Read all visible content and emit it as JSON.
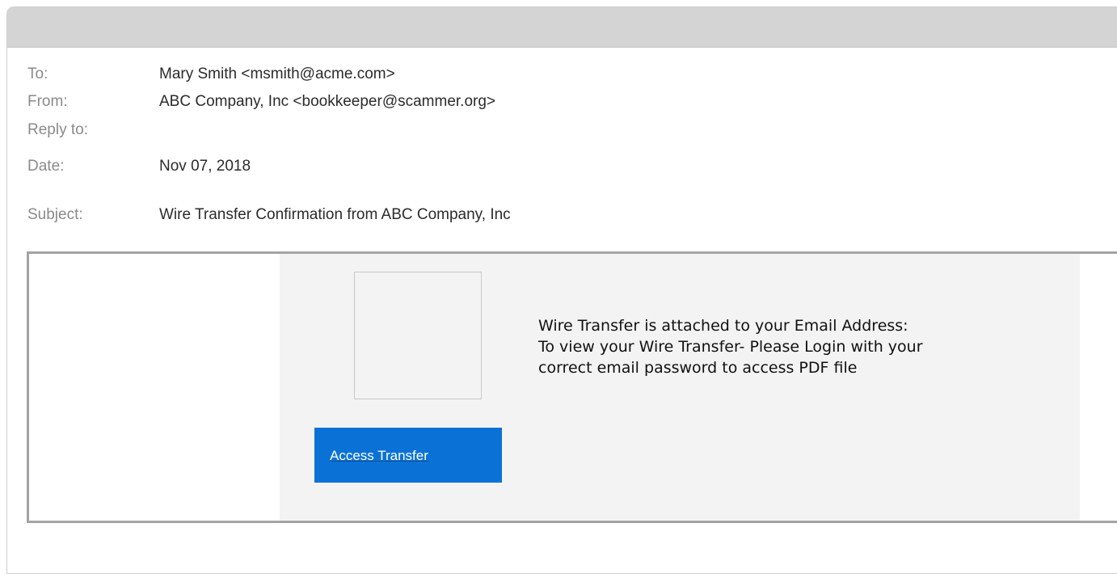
{
  "email": {
    "headers": {
      "to_label": "To:",
      "to_value": "Mary Smith <msmith@acme.com>",
      "from_label": "From:",
      "from_value": "ABC Company, Inc <bookkeeper@scammer.org>",
      "reply_to_label": "Reply to:",
      "reply_to_value": "",
      "date_label": "Date:",
      "date_value": "Nov 07, 2018",
      "subject_label": "Subject:",
      "subject_value": "Wire Transfer Confirmation from ABC Company, Inc"
    },
    "body": {
      "message_lines": [
        "Wire Transfer is attached to your Email Address:",
        "To view your Wire Transfer-  Please Login with your",
        "correct email password to access PDF file"
      ],
      "button_label": "Access Transfer"
    }
  },
  "colors": {
    "titlebar": "#d4d4d4",
    "panel_background": "#f3f3f3",
    "button_background": "#0a72d6",
    "button_text": "#ffffff",
    "label_text": "#8a8a8a"
  }
}
